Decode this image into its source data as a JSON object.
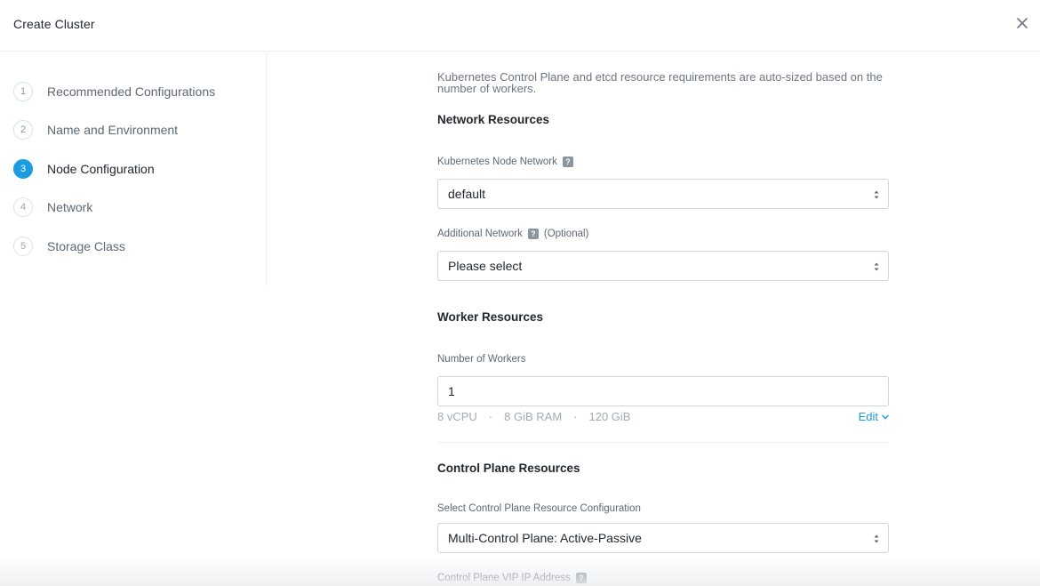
{
  "dialog": {
    "title": "Create Cluster",
    "close_icon": "close-icon"
  },
  "sidebar": {
    "steps": [
      {
        "number": "1",
        "label": "Recommended Configurations",
        "state": "completed"
      },
      {
        "number": "2",
        "label": "Name and Environment",
        "state": "completed"
      },
      {
        "number": "3",
        "label": "Node Configuration",
        "state": "active"
      },
      {
        "number": "4",
        "label": "Network",
        "state": "upcoming"
      },
      {
        "number": "5",
        "label": "Storage Class",
        "state": "upcoming"
      }
    ]
  },
  "main": {
    "intro": "Kubernetes Control Plane and etcd resource requirements are auto-sized based on the number of workers.",
    "network": {
      "title": "Network Resources",
      "node_network_label": "Kubernetes Node Network",
      "node_network_value": "default",
      "additional_network_label": "Additional Network",
      "additional_network_optional": "(Optional)",
      "additional_network_value": "Please select"
    },
    "workers": {
      "title": "Worker Resources",
      "count_label": "Number of Workers",
      "count_value": "1",
      "cpu": "8 vCPU",
      "ram": "8 GiB RAM",
      "storage": "120 GiB",
      "separator": "·",
      "edit_label": "Edit"
    },
    "control_plane": {
      "title": "Control Plane Resources",
      "config_label": "Select Control Plane Resource Configuration",
      "config_value": "Multi-Control Plane: Active-Passive",
      "vip_label": "Control Plane VIP IP Address"
    },
    "help_icon_glyph": "?"
  },
  "colors": {
    "accent": "#1b9be0",
    "text": "#22272e",
    "muted": "#5d6873",
    "border": "#cfd5db"
  }
}
